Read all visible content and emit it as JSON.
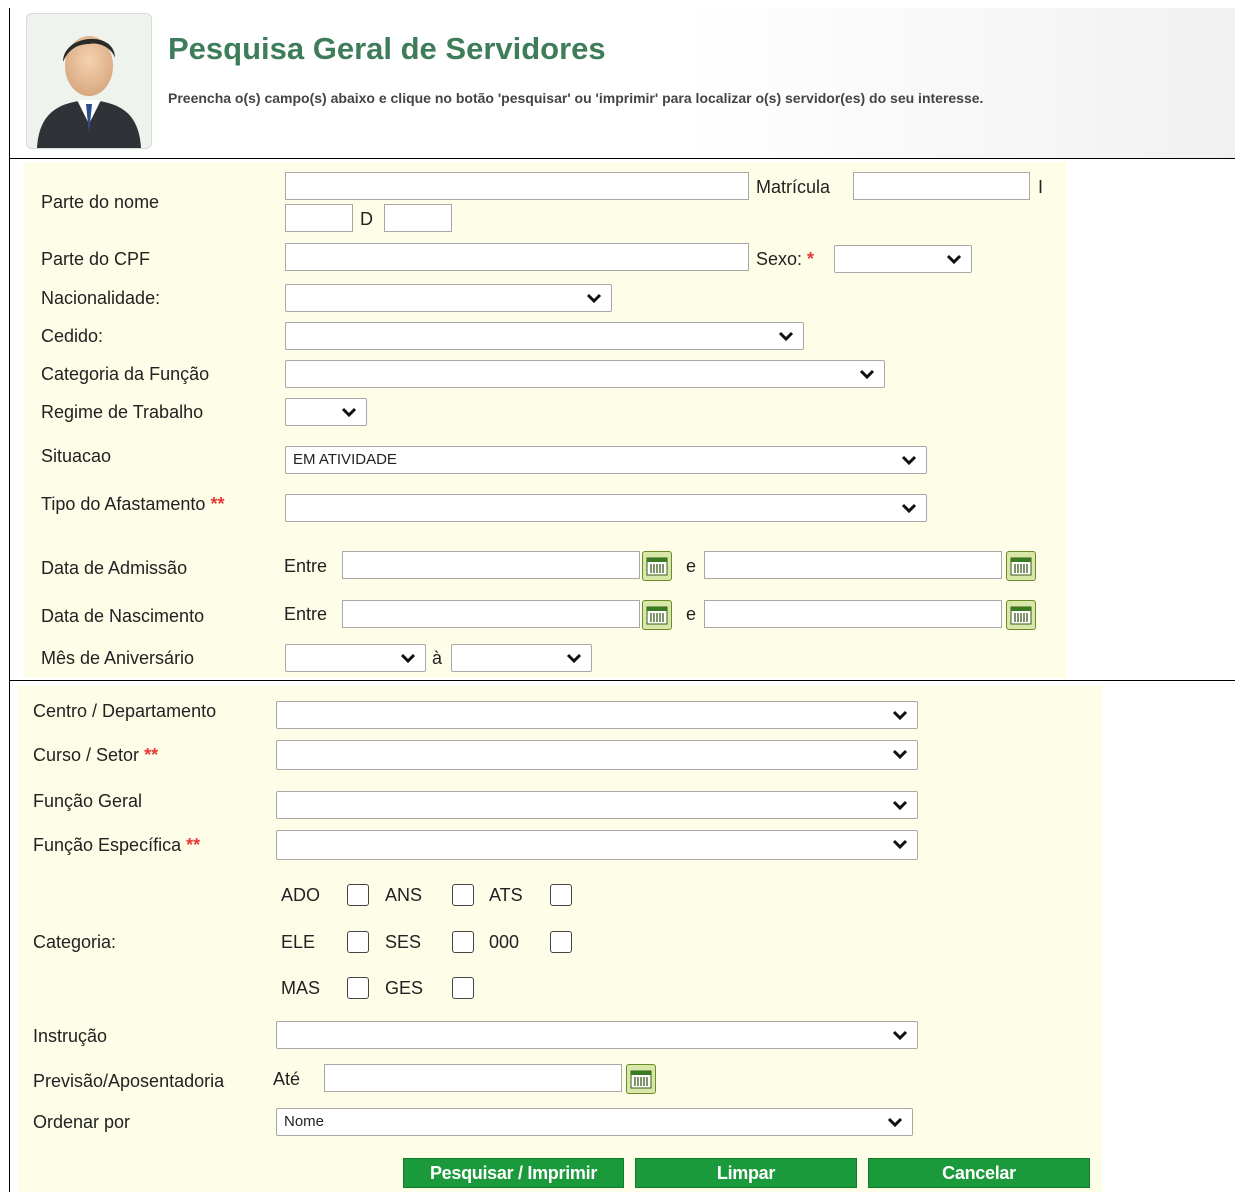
{
  "header": {
    "title": "Pesquisa Geral de Servidores",
    "subtitle": "Preencha o(s) campo(s) abaixo e clique no botão 'pesquisar' ou 'imprimir' para localizar o(s) servidor(es) do seu interesse."
  },
  "form1": {
    "parte_nome_label": "Parte do nome",
    "matricula_label": "Matrícula",
    "i_label": "I",
    "d_label": "D",
    "parte_cpf_label": "Parte do CPF",
    "sexo_label": "Sexo:",
    "required_mark": "*",
    "nacionalidade_label": "Nacionalidade:",
    "cedido_label": "Cedido:",
    "categoria_funcao_label": "Categoria da Função",
    "regime_label": "Regime de Trabalho",
    "situacao_label": "Situacao",
    "situacao_value": "EM ATIVIDADE",
    "tipo_afastamento_label": "Tipo do Afastamento",
    "double_required_mark": "**",
    "data_admissao_label": "Data de Admissão",
    "data_nascimento_label": "Data de Nascimento",
    "entre_label": "Entre",
    "e_label": "e",
    "mes_aniversario_label": "Mês de Aniversário",
    "a_label": "à"
  },
  "form2": {
    "centro_label": "Centro / Departamento",
    "curso_label": "Curso / Setor",
    "funcao_geral_label": "Função Geral",
    "funcao_especifica_label": "Função Específica",
    "categoria_label": "Categoria:",
    "categorias": [
      "ADO",
      "ANS",
      "ATS",
      "ELE",
      "SES",
      "000",
      "MAS",
      "GES"
    ],
    "instrucao_label": "Instrução",
    "previsao_label": "Previsão/Aposentadoria",
    "ate_label": "Até",
    "ordenar_label": "Ordenar por",
    "ordenar_value": "Nome"
  },
  "buttons": {
    "pesquisar": "Pesquisar / Imprimir",
    "limpar": "Limpar",
    "cancelar": "Cancelar"
  },
  "colors": {
    "title": "#3f7d5a",
    "panel": "#fdfde8",
    "button": "#1a9a3a",
    "required": "#e53935"
  }
}
